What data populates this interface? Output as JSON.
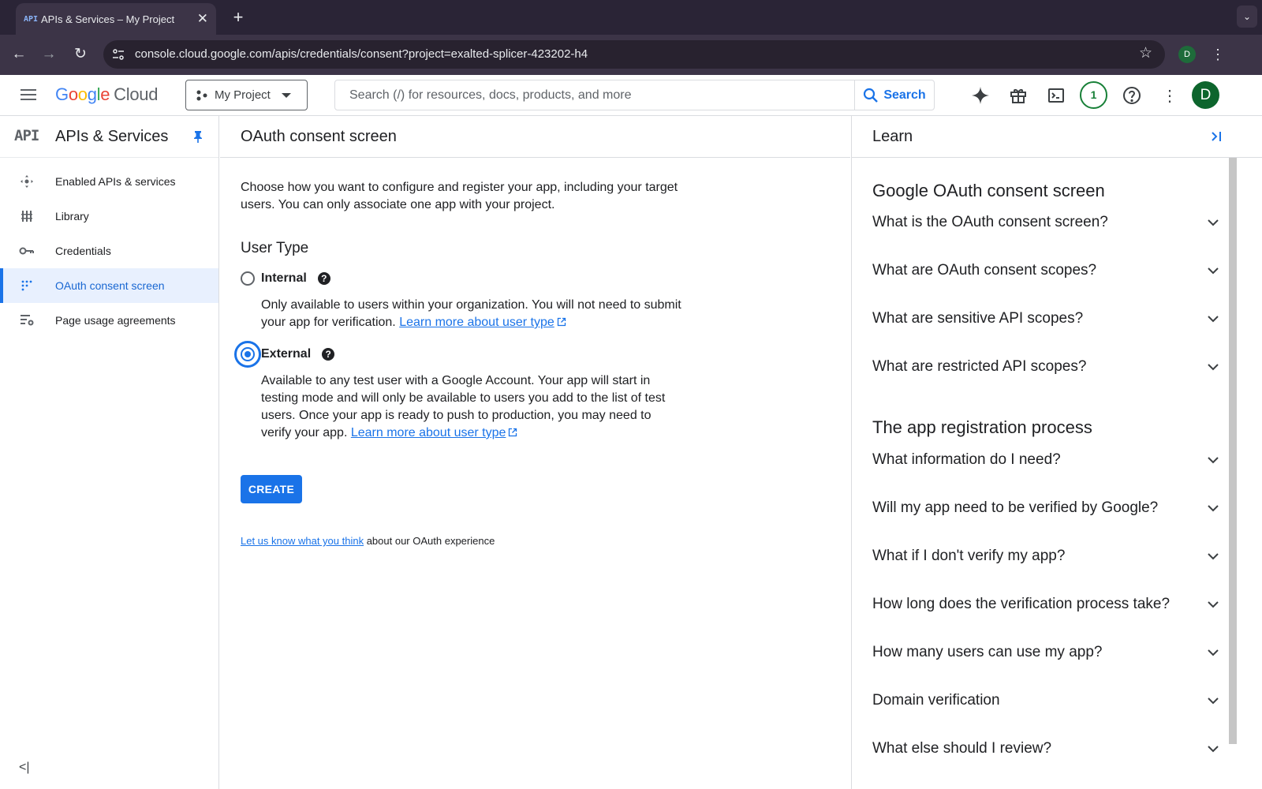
{
  "browser": {
    "tab_title": "APIs & Services – My Project",
    "tab_favicon_text": "API",
    "url": "console.cloud.google.com/apis/credentials/consent?project=exalted-splicer-423202-h4",
    "profile_initial": "D"
  },
  "header": {
    "logo_word": "Google",
    "logo_suffix": "Cloud",
    "project_name": "My Project",
    "search_placeholder": "Search (/) for resources, docs, products, and more",
    "search_button": "Search",
    "notifications_count": "1",
    "avatar_initial": "D"
  },
  "sidebar": {
    "api_mark": "API",
    "title": "APIs & Services",
    "items": [
      {
        "label": "Enabled APIs & services",
        "icon": "enabled-apis-icon",
        "active": false
      },
      {
        "label": "Library",
        "icon": "library-icon",
        "active": false
      },
      {
        "label": "Credentials",
        "icon": "key-icon",
        "active": false
      },
      {
        "label": "OAuth consent screen",
        "icon": "consent-grid-icon",
        "active": true
      },
      {
        "label": "Page usage agreements",
        "icon": "settings-list-icon",
        "active": false
      }
    ]
  },
  "main": {
    "title": "OAuth consent screen",
    "intro": "Choose how you want to configure and register your app, including your target users. You can only associate one app with your project.",
    "user_type_heading": "User Type",
    "internal": {
      "label": "Internal",
      "description": "Only available to users within your organization. You will not need to submit your app for verification.",
      "link": "Learn more about user type",
      "selected": false
    },
    "external": {
      "label": "External",
      "description": "Available to any test user with a Google Account. Your app will start in testing mode and will only be available to users you add to the list of test users. Once your app is ready to push to production, you may need to verify your app.",
      "link": "Learn more about user type",
      "selected": true
    },
    "create_button": "CREATE",
    "feedback_link": "Let us know what you think",
    "feedback_text": " about our OAuth experience"
  },
  "learn": {
    "title": "Learn",
    "sections": [
      {
        "title": "Google OAuth consent screen",
        "questions": [
          "What is the OAuth consent screen?",
          "What are OAuth consent scopes?",
          "What are sensitive API scopes?",
          "What are restricted API scopes?"
        ]
      },
      {
        "title": "The app registration process",
        "questions": [
          "What information do I need?",
          "Will my app need to be verified by Google?",
          "What if I don't verify my app?",
          "How long does the verification process take?",
          "How many users can use my app?",
          "Domain verification",
          "What else should I review?"
        ]
      }
    ]
  },
  "colors": {
    "accent": "#1a73e8",
    "chrome_dark": "#2a2436",
    "active_bg": "#e8f0fe"
  }
}
